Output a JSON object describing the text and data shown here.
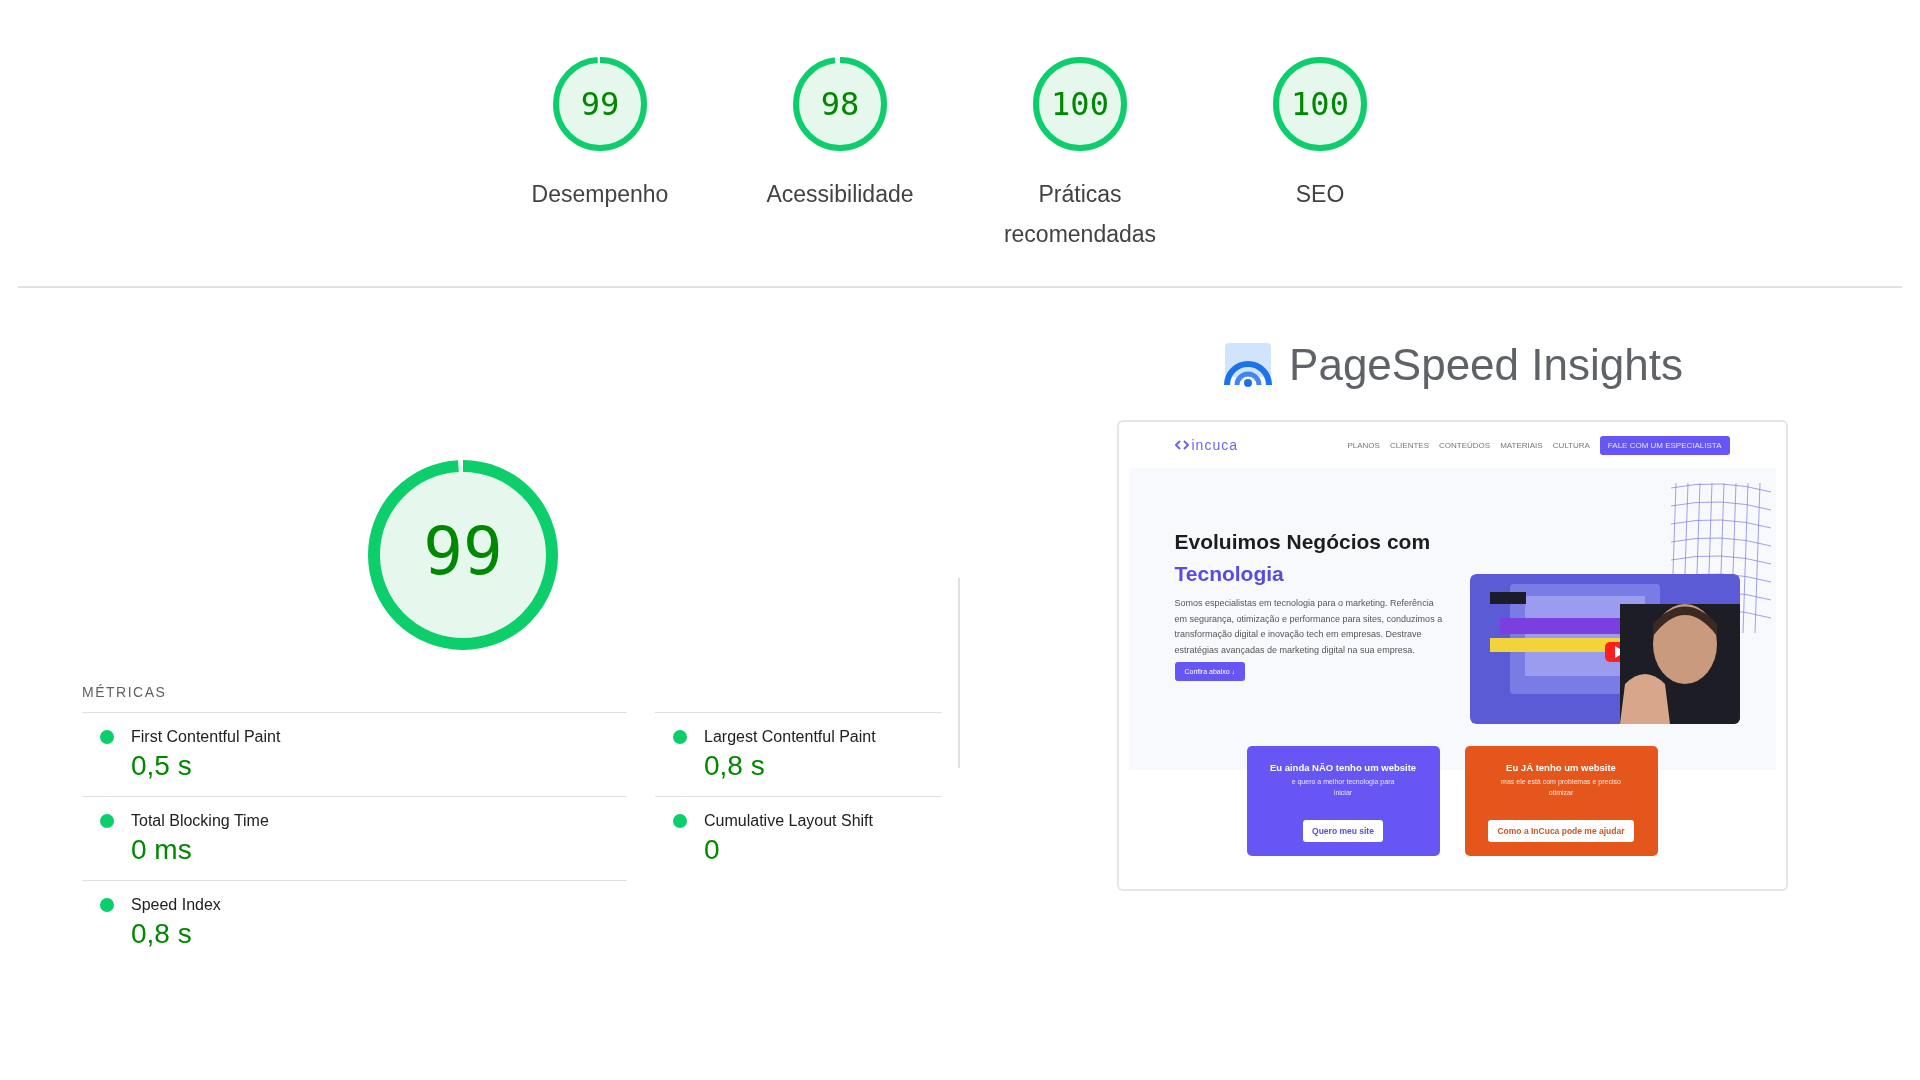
{
  "categories": [
    {
      "score": "99",
      "level": 0.99,
      "label": "Desempenho"
    },
    {
      "score": "98",
      "level": 0.98,
      "label": "Acessibilidade"
    },
    {
      "score": "100",
      "level": 1,
      "label": "Práticas recomendadas"
    },
    {
      "score": "100",
      "level": 1,
      "label": "SEO"
    }
  ],
  "main_gauge": {
    "score": "99",
    "level": 0.99
  },
  "metrics_heading": "MÉTRICAS",
  "metrics": [
    {
      "name": "First Contentful Paint",
      "value": "0,5 s"
    },
    {
      "name": "Largest Contentful Paint",
      "value": "0,8 s"
    },
    {
      "name": "Total Blocking Time",
      "value": "0 ms"
    },
    {
      "name": "Cumulative Layout Shift",
      "value": "0"
    },
    {
      "name": "Speed Index",
      "value": "0,8 s"
    }
  ],
  "brand": "PageSpeed Insights",
  "site_preview": {
    "logo": "incuca",
    "nav": [
      "PLANOS",
      "CLIENTES",
      "CONTEÚDOS",
      "MATERIAIS",
      "CULTURA"
    ],
    "nav_button": "FALE COM UM ESPECIALISTA",
    "headline": "Evoluimos Negócios com",
    "headline_accent": "Tecnologia",
    "intro": "Somos especialistas em tecnologia para o marketing. Referência em segurança, otimização e performance para sites, conduzimos a transformação digital e inovação tech em empresas. Destrave estratégias avançadas de marketing digital na sua empresa.",
    "cta": "Confira abaixo ↓",
    "cards": [
      {
        "kind": "violet",
        "title": "Eu ainda NÃO tenho um website",
        "subtitle": "e quero a melhor tecnologia para iniciar",
        "button": "Quero meu site"
      },
      {
        "kind": "orange",
        "title": "Eu JÁ tenho um website",
        "subtitle": "mas ele está com problemas e preciso otimizar",
        "button": "Como a InCuca pode me ajudar"
      }
    ]
  }
}
